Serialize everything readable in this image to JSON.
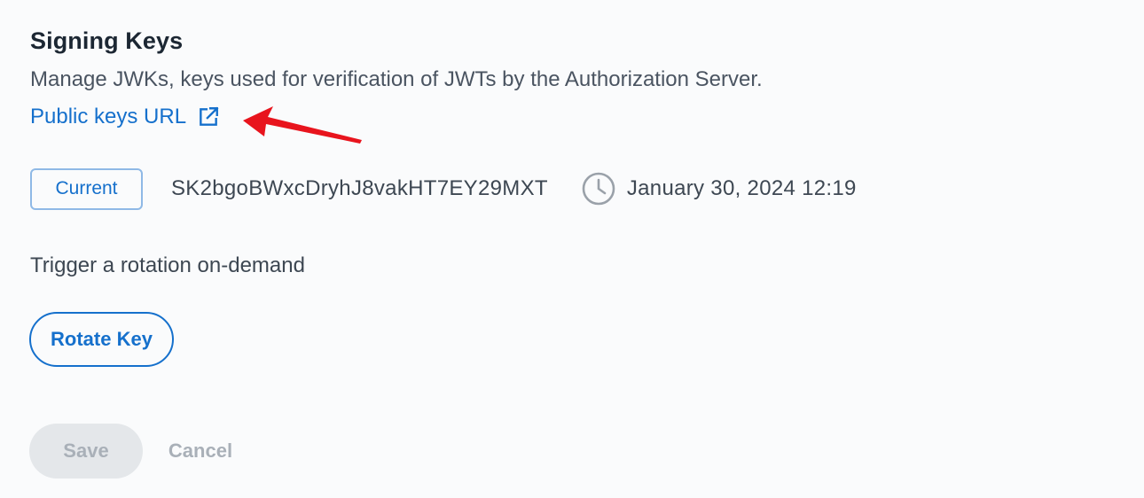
{
  "signing_keys": {
    "title": "Signing Keys",
    "description": "Manage JWKs, keys used for verification of JWTs by the Authorization Server.",
    "public_keys_link": {
      "label": "Public keys URL",
      "icon": "external-link-icon"
    }
  },
  "current_key": {
    "badge": "Current",
    "key_id": "SK2bgoBWxcDryhJ8vakHT7EY29MXT",
    "created_icon": "clock-icon",
    "created": "January 30, 2024 12:19"
  },
  "rotation": {
    "label": "Trigger a rotation on-demand",
    "button_label": "Rotate Key"
  },
  "form_actions": {
    "save_label": "Save",
    "cancel_label": "Cancel",
    "save_enabled": false,
    "cancel_enabled": false
  },
  "annotation": {
    "arrow_color": "#e8141d"
  },
  "colors": {
    "accent": "#1570cc",
    "badge_border": "#8fb9e6",
    "text_primary": "#1c2733",
    "text_secondary": "#4a5461",
    "disabled_bg": "#e4e7ea",
    "disabled_text": "#a9b0b8",
    "background": "#fafbfc"
  }
}
